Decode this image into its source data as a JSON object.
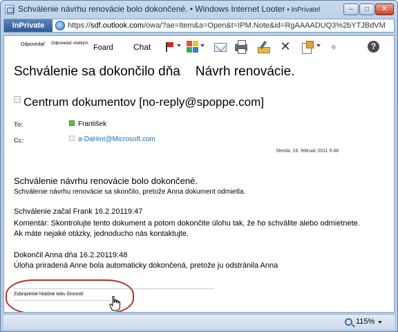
{
  "window": {
    "title_main": "Schválenie návrhu renovácie bolo dokončené.",
    "title_sep": " • Windows Internet ",
    "title_app": "Looter",
    "title_mode": " • InPrivatel"
  },
  "address": {
    "inprivate_label": "InPrivate",
    "url_prefix": "https://",
    "url_host": "sdf.outlook.com",
    "url_rest": "/owa/?ae=Item&a=Open&t=IPM.Note&id=RgAAAADUQ3%2bYTJBdVM"
  },
  "toolbar": {
    "reply_label": "Odpovedať",
    "reply_all_label": "Odpovedať všetkým",
    "forward_label": "Foard",
    "chat_label": "Chat"
  },
  "message": {
    "subject_part1": "Schválenie sa dokončilo dňa",
    "subject_part2": "Návrh renovácie.",
    "sender": "Centrum dokumentov [no-reply@spoppe.com]",
    "to_label": "To:",
    "to_value": "František",
    "cc_label": "Cc:",
    "cc_value": "a-DaHint@Microsoft.com",
    "date": "Streda, 16. február 2011 9:48"
  },
  "body": {
    "heading": "Schválenie návrhu renovácie bolo dokončené.",
    "summary": "Schválenie návrhu renovácie sa skončilo, pretože Anna dokument odmietla.",
    "started": "Schválenie začal Frank 16.2.20119:47",
    "comment": "Komentár: Skontrolujte tento dokument a potom dokončite úlohu tak, že ho schválite alebo odmietnete.",
    "contact": "Ak máte nejaké otázky, jednoducho nás kontaktujte.",
    "completed": "Dokončil Anna dňa 16.2.20119:48",
    "task_note": "Úloha priradená Anne bola automaticky dokončená, pretože ju odstránila Anna",
    "history_link": "Zobrazenie histórie toku činností"
  },
  "status": {
    "zoom": "115%"
  },
  "colors": {
    "accent": "#1a6fb8",
    "highlight_circle": "#b0312f",
    "inprivate_bg": "#2d5b96"
  },
  "icons": [
    "app-icon",
    "globe-page-icon",
    "flag-icon",
    "categorize-icon",
    "envelope-icon",
    "print-icon",
    "pen-icon",
    "close-icon",
    "move-icon",
    "up-icon",
    "help-icon",
    "presence-icon",
    "zoom-icon",
    "hand-cursor-icon"
  ]
}
